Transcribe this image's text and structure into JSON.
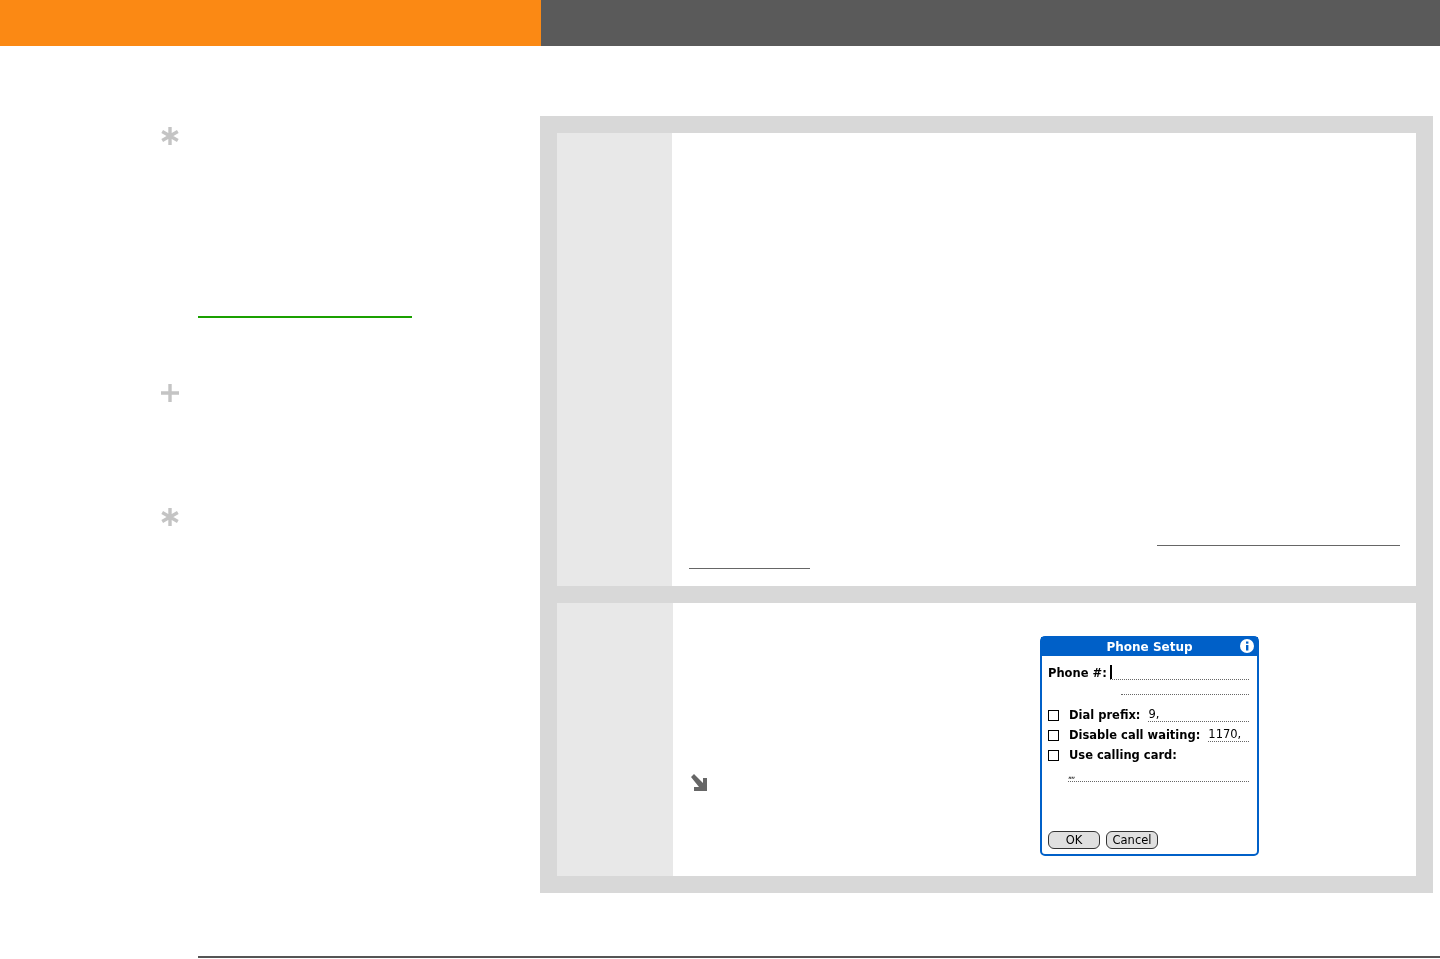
{
  "sidebar_marks": [
    {
      "kind": "asterisk"
    },
    {
      "kind": "plus"
    },
    {
      "kind": "asterisk"
    }
  ],
  "dialog": {
    "title": "Phone Setup",
    "phone_label": "Phone #:",
    "options": [
      {
        "label": "Dial prefix:",
        "value": "9,",
        "checked": false
      },
      {
        "label": "Disable call waiting:",
        "value": "1170,",
        "checked": false
      },
      {
        "label": "Use calling card:",
        "checked": false
      }
    ],
    "calling_card_value": ",,,,",
    "buttons": [
      "OK",
      "Cancel"
    ]
  }
}
